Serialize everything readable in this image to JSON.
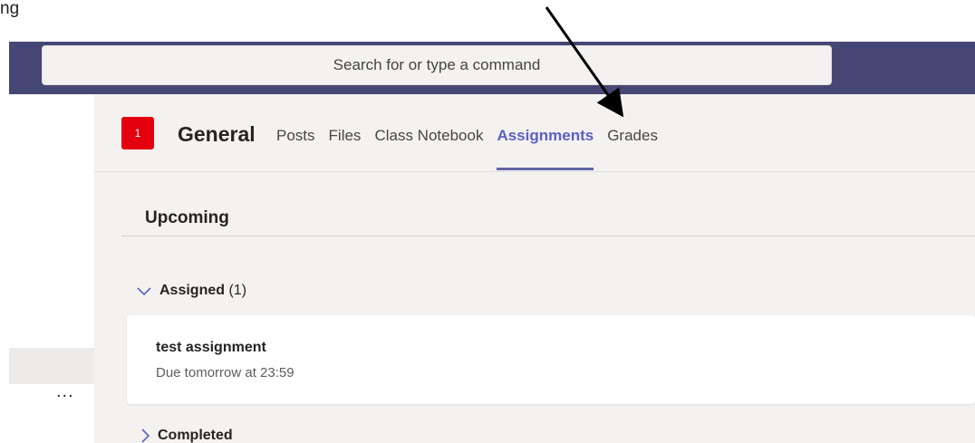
{
  "caption_text": "ng",
  "search": {
    "placeholder": "Search for or type a command"
  },
  "rail": {
    "more_label": "..."
  },
  "team": {
    "tile_label": "1",
    "tile_color": "#e3000f"
  },
  "channel": {
    "name": "General"
  },
  "tabs": [
    {
      "label": "Posts",
      "active": false
    },
    {
      "label": "Files",
      "active": false
    },
    {
      "label": "Class Notebook",
      "active": false
    },
    {
      "label": "Assignments",
      "active": true
    },
    {
      "label": "Grades",
      "active": false
    }
  ],
  "section": {
    "title": "Upcoming"
  },
  "groups": {
    "assigned": {
      "label": "Assigned",
      "count": "(1)",
      "icon": "chevron-down-icon"
    },
    "completed": {
      "label": "Completed",
      "icon": "chevron-right-icon"
    }
  },
  "assignments": [
    {
      "title": "test assignment",
      "due": "Due tomorrow at 23:59"
    }
  ],
  "colors": {
    "top_bar": "#464775",
    "accent": "#5b5fc7",
    "canvas": "#f3f2f1"
  }
}
